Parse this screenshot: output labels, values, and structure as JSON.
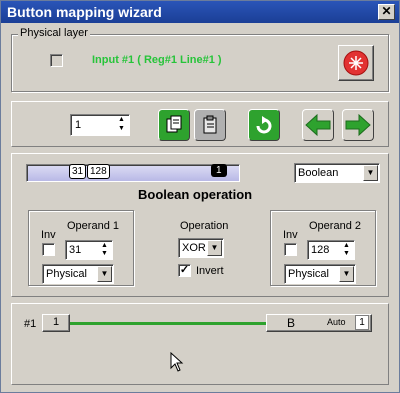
{
  "window": {
    "title": "Button mapping wizard",
    "close_glyph": "✕"
  },
  "physical": {
    "group_label": "Physical layer",
    "input_text": "Input #1  ( Reg#1  Line#1 )",
    "input_color": "#27c43a"
  },
  "toolbar": {
    "index_value": "1",
    "icons": [
      "copy-green-icon",
      "paste-gray-icon",
      "refresh-icon",
      "arrow-left-icon",
      "arrow-right-icon"
    ]
  },
  "mapping": {
    "slider_values": [
      "31",
      "128"
    ],
    "slider_end_value": "1",
    "type_select": "Boolean",
    "heading": "Boolean operation"
  },
  "operand1": {
    "title": "Operand 1",
    "inv_label": "Inv",
    "value": "31",
    "source": "Physical"
  },
  "operation": {
    "title": "Operation",
    "value": "XOR",
    "invert_label": "Invert",
    "invert_checked": true,
    "check_glyph": "✓"
  },
  "operand2": {
    "title": "Operand 2",
    "inv_label": "Inv",
    "value": "128",
    "source": "Physical"
  },
  "output": {
    "row_label": "#1",
    "start_value": "1",
    "end_label": "B",
    "auto_label": "Auto",
    "auto_value": "1",
    "line_color": "#2ea22e"
  }
}
